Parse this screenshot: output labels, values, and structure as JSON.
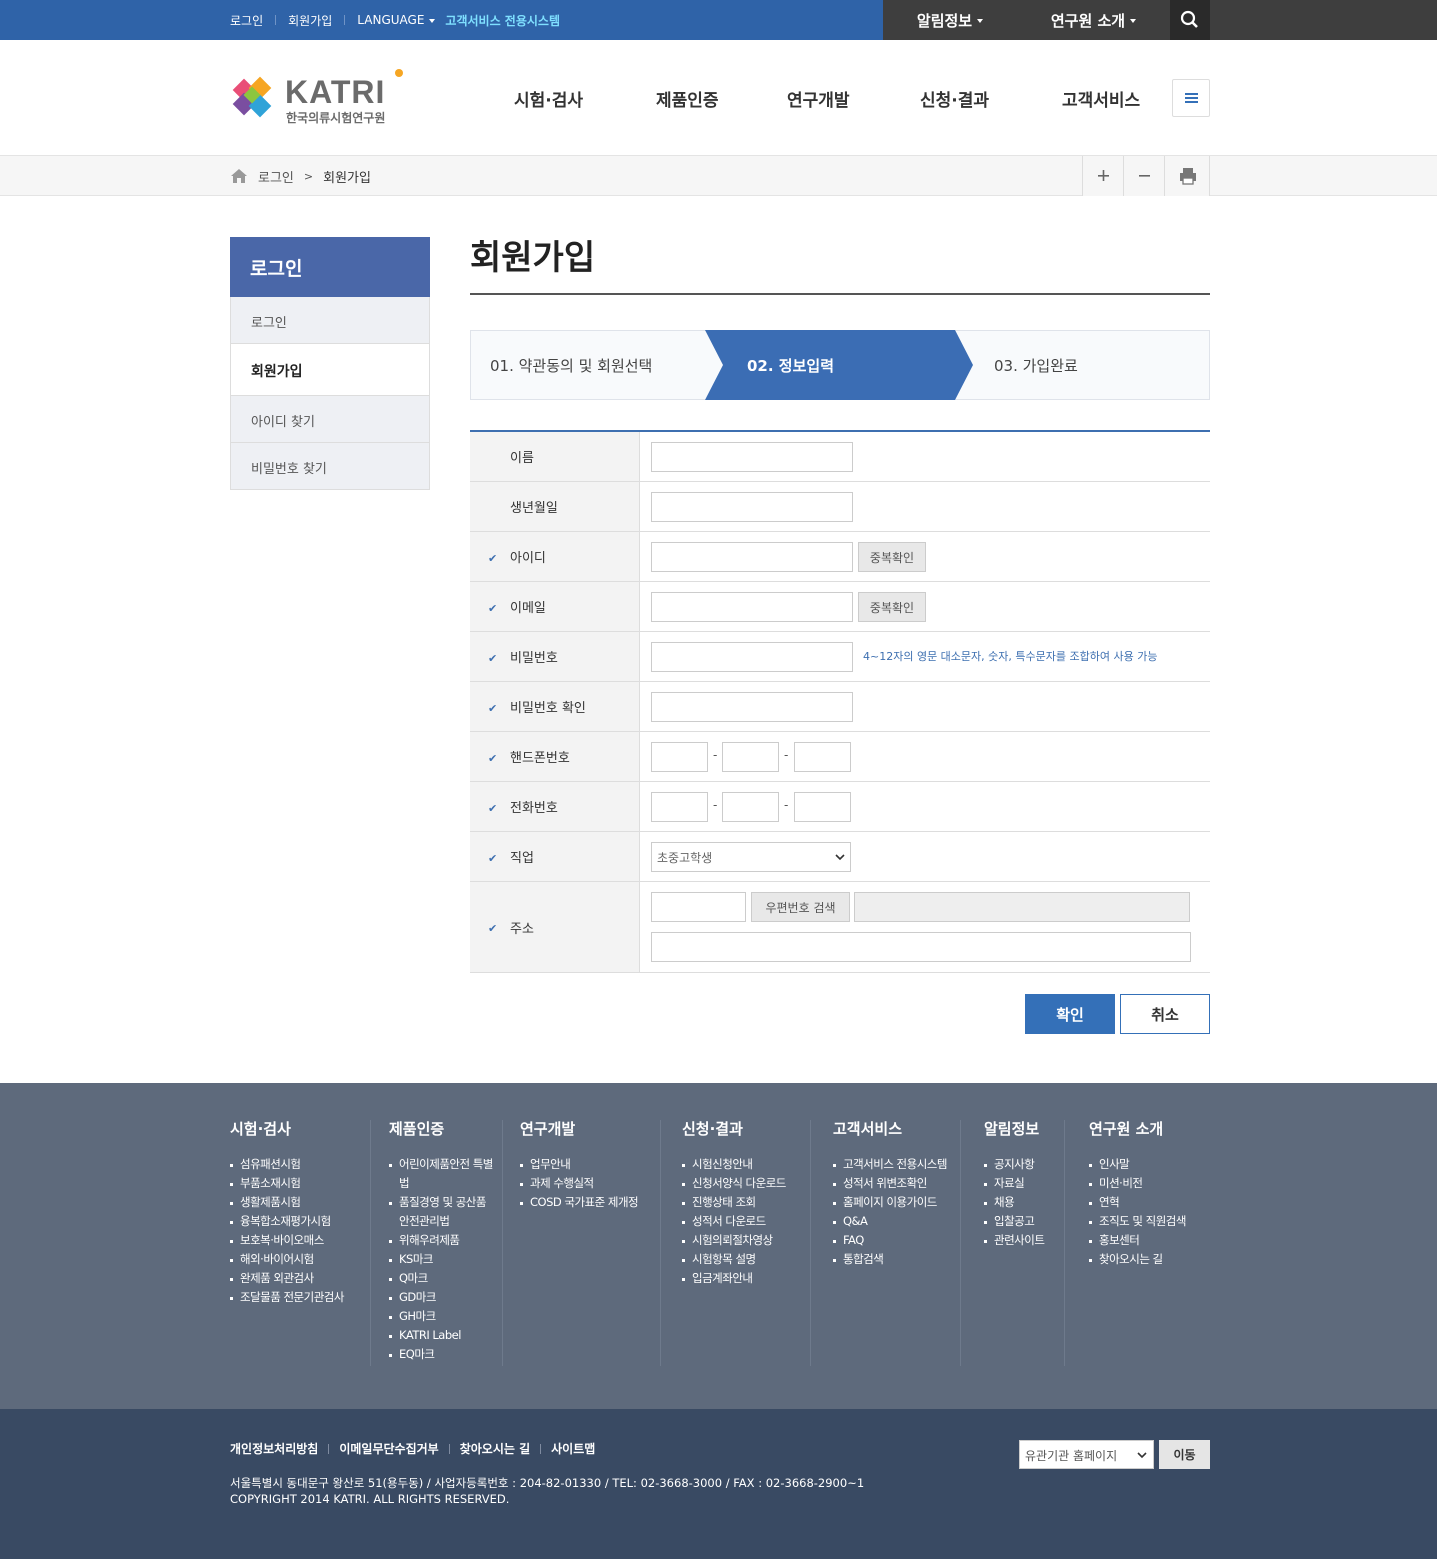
{
  "topbar": {
    "login": "로그인",
    "join": "회원가입",
    "language": "LANGUAGE",
    "customer_system": "고객서비스 전용시스템",
    "notice": "알림정보",
    "about": "연구원 소개"
  },
  "header": {
    "logo_text": "KATRI",
    "logo_sub": "한국의류시험연구원",
    "gnb": [
      "시험·검사",
      "제품인증",
      "연구개발",
      "신청·결과",
      "고객서비스"
    ]
  },
  "breadcrumb": {
    "home": "로그인",
    "sep": ">",
    "current": "회원가입"
  },
  "lnb": {
    "title": "로그인",
    "items": [
      "로그인",
      "회원가입",
      "아이디 찾기",
      "비밀번호 찾기"
    ]
  },
  "page": {
    "title": "회원가입",
    "steps": [
      "01. 약관동의 및 회원선택",
      "02. 정보입력",
      "03. 가입완료"
    ]
  },
  "form": {
    "name": "이름",
    "birth": "생년월일",
    "id": "아이디",
    "email": "이메일",
    "password": "비밀번호",
    "password_confirm": "비밀번호 확인",
    "mobile": "핸드폰번호",
    "phone": "전화번호",
    "job": "직업",
    "address": "주소",
    "dup_check": "중복확인",
    "password_hint": "4~12자의 영문 대소문자, 숫자, 특수문자를 조합하여 사용 가능",
    "dash": "-",
    "job_value": "초중고학생",
    "zip_search": "우편번호 검색",
    "confirm": "확인",
    "cancel": "취소"
  },
  "footer_menu": [
    {
      "title": "시험·검사",
      "items": [
        "섬유패션시험",
        "부품소재시험",
        "생활제품시험",
        "융복합소재평가시험",
        "보호복·바이오매스",
        "해외·바이어시험",
        "완제품 외관검사",
        "조달물품 전문기관검사"
      ]
    },
    {
      "title": "제품인증",
      "items": [
        "어린이제품안전 특별법",
        "품질경영 및 공산품 안전관리법",
        "위해우려제품",
        "KS마크",
        "Q마크",
        "GD마크",
        "GH마크",
        "KATRI Label",
        "EQ마크"
      ]
    },
    {
      "title": "연구개발",
      "items": [
        "업무안내",
        "과제 수행실적",
        "COSD 국가표준 제개정"
      ]
    },
    {
      "title": "신청·결과",
      "items": [
        "시험신청안내",
        "신청서양식 다운로드",
        "진행상태 조회",
        "성적서 다운로드",
        "시험의뢰절차영상",
        "시험항목 설명",
        "입금계좌안내"
      ]
    },
    {
      "title": "고객서비스",
      "items": [
        "고객서비스 전용시스템",
        "성적서 위변조확인",
        "홈페이지 이용가이드",
        "Q&A",
        "FAQ",
        "통합검색"
      ]
    },
    {
      "title": "알림정보",
      "items": [
        "공지사항",
        "자료실",
        "채용",
        "입찰공고",
        "관련사이트"
      ]
    },
    {
      "title": "연구원 소개",
      "items": [
        "인사말",
        "미션·비전",
        "연혁",
        "조직도 및 직원검색",
        "홍보센터",
        "찾아오시는 길"
      ]
    }
  ],
  "footer": {
    "links": [
      "개인정보처리방침",
      "이메일무단수집거부",
      "찾아오시는 길",
      "사이트맵"
    ],
    "address": "서울특별시 동대문구 왕산로 51(용두동) / 사업자등록번호 : 204-82-01330 / TEL: 02-3668-3000 / FAX : 02-3668-2900~1",
    "copyright": "COPYRIGHT 2014 KATRI. ALL RIGHTS RESERVED.",
    "related_select": "유관기관 홈페이지",
    "go": "이동"
  },
  "colors": {
    "primary": "#2f63a8",
    "lnb": "#4a67a8",
    "footer_top": "#5e6a7c",
    "footer_bottom": "#394a63"
  }
}
